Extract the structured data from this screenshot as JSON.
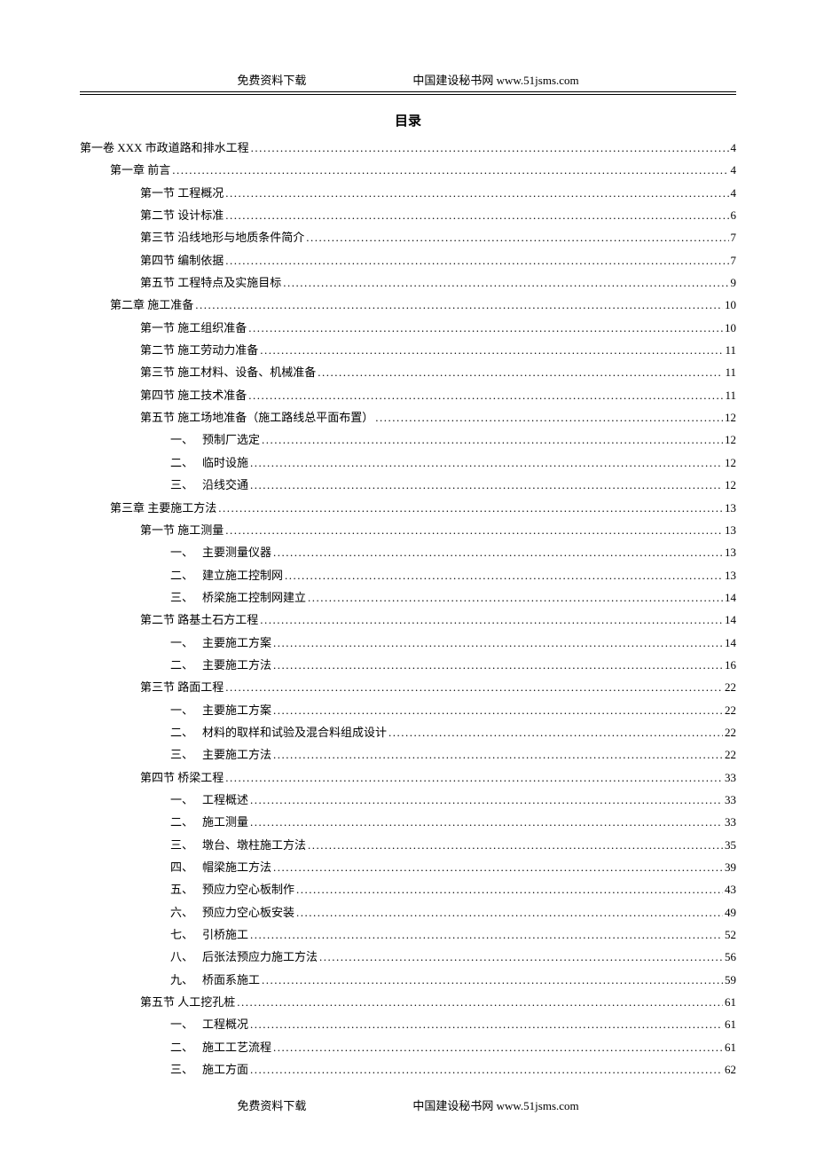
{
  "header": {
    "left": "免费资料下载",
    "right": "中国建设秘书网 www.51jsms.com"
  },
  "title": "目录",
  "toc": [
    {
      "level": 0,
      "label": "第一卷 XXX 市政道路和排水工程",
      "page": "4"
    },
    {
      "level": 1,
      "label": "第一章 前言",
      "page": "4"
    },
    {
      "level": 2,
      "label": "第一节 工程概况",
      "page": "4"
    },
    {
      "level": 2,
      "label": "第二节 设计标准",
      "page": "6"
    },
    {
      "level": 2,
      "label": "第三节 沿线地形与地质条件简介",
      "page": "7"
    },
    {
      "level": 2,
      "label": "第四节 编制依据",
      "page": "7"
    },
    {
      "level": 2,
      "label": "第五节 工程特点及实施目标",
      "page": "9"
    },
    {
      "level": 1,
      "label": "第二章 施工准备",
      "page": "10"
    },
    {
      "level": 2,
      "label": "第一节 施工组织准备",
      "page": "10"
    },
    {
      "level": 2,
      "label": "第二节 施工劳动力准备",
      "page": "11"
    },
    {
      "level": 2,
      "label": "第三节 施工材料、设备、机械准备",
      "page": "11"
    },
    {
      "level": 2,
      "label": "第四节 施工技术准备",
      "page": "11"
    },
    {
      "level": 2,
      "label": "第五节 施工场地准备（施工路线总平面布置）",
      "page": "12"
    },
    {
      "level": 3,
      "marker": "一、",
      "label": "预制厂选定",
      "page": "12"
    },
    {
      "level": 3,
      "marker": "二、",
      "label": "临时设施",
      "page": "12"
    },
    {
      "level": 3,
      "marker": "三、",
      "label": "沿线交通",
      "page": "12"
    },
    {
      "level": 1,
      "label": "第三章 主要施工方法",
      "page": "13"
    },
    {
      "level": 2,
      "label": "第一节 施工测量",
      "page": "13"
    },
    {
      "level": 3,
      "marker": "一、",
      "label": "主要测量仪器",
      "page": "13"
    },
    {
      "level": 3,
      "marker": "二、",
      "label": "建立施工控制网",
      "page": "13"
    },
    {
      "level": 3,
      "marker": "三、",
      "label": "桥梁施工控制网建立",
      "page": "14"
    },
    {
      "level": 2,
      "label": "第二节 路基土石方工程",
      "page": "14"
    },
    {
      "level": 3,
      "marker": "一、",
      "label": "主要施工方案",
      "page": "14"
    },
    {
      "level": 3,
      "marker": "二、",
      "label": "主要施工方法",
      "page": "16"
    },
    {
      "level": 2,
      "label": "第三节 路面工程",
      "page": "22"
    },
    {
      "level": 3,
      "marker": "一、",
      "label": "主要施工方案",
      "page": "22"
    },
    {
      "level": 3,
      "marker": "二、",
      "label": "材料的取样和试验及混合料组成设计",
      "page": "22"
    },
    {
      "level": 3,
      "marker": "三、",
      "label": "主要施工方法",
      "page": "22"
    },
    {
      "level": 2,
      "label": "第四节 桥梁工程",
      "page": "33"
    },
    {
      "level": 3,
      "marker": "一、",
      "label": "工程概述",
      "page": "33"
    },
    {
      "level": 3,
      "marker": "二、",
      "label": "施工测量",
      "page": "33"
    },
    {
      "level": 3,
      "marker": "三、",
      "label": "墩台、墩柱施工方法",
      "page": "35"
    },
    {
      "level": 3,
      "marker": "四、",
      "label": "帽梁施工方法",
      "page": "39"
    },
    {
      "level": 3,
      "marker": "五、",
      "label": "预应力空心板制作",
      "page": "43"
    },
    {
      "level": 3,
      "marker": "六、",
      "label": "预应力空心板安装",
      "page": "49"
    },
    {
      "level": 3,
      "marker": "七、",
      "label": "引桥施工",
      "page": "52"
    },
    {
      "level": 3,
      "marker": "八、",
      "label": "后张法预应力施工方法",
      "page": "56"
    },
    {
      "level": 3,
      "marker": "九、",
      "label": "桥面系施工",
      "page": "59"
    },
    {
      "level": 2,
      "label": "第五节 人工挖孔桩",
      "page": "61"
    },
    {
      "level": 3,
      "marker": "一、",
      "label": "工程概况",
      "page": "61"
    },
    {
      "level": 3,
      "marker": "二、",
      "label": "施工工艺流程",
      "page": "61"
    },
    {
      "level": 3,
      "marker": "三、",
      "label": "施工方面",
      "page": "62"
    }
  ],
  "footer": {
    "left": "免费资料下载",
    "right": "中国建设秘书网 www.51jsms.com"
  }
}
